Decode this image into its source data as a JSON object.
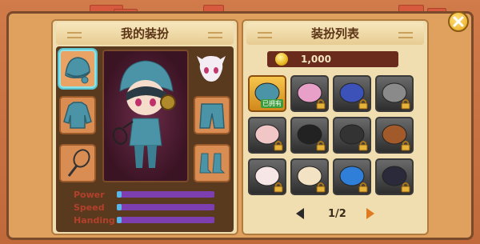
{
  "left_panel": {
    "title": "我的装扮"
  },
  "right_panel": {
    "title": "装扮列表"
  },
  "currency": {
    "amount": "1,000",
    "icon": "coin-icon"
  },
  "stats": [
    {
      "label": "Power",
      "value": 0.05
    },
    {
      "label": "Speed",
      "value": 0.05
    },
    {
      "label": "Handing",
      "value": 0.05
    }
  ],
  "equipped_slots": [
    "hat-slot",
    "top-slot",
    "racket-slot",
    "pants-slot",
    "shoes-slot"
  ],
  "items": [
    {
      "name": "blue-cap-item",
      "owned": true,
      "owned_label": "已拥有"
    },
    {
      "name": "pink-helmet-item",
      "owned": false
    },
    {
      "name": "blue-helmet-item",
      "owned": false
    },
    {
      "name": "cat-hat-item",
      "owned": false
    },
    {
      "name": "piggy-hat-item",
      "owned": false
    },
    {
      "name": "black-helmet-item",
      "owned": false
    },
    {
      "name": "black-cap-item",
      "owned": false
    },
    {
      "name": "bear-hat-item",
      "owned": false
    },
    {
      "name": "bunny-hat-item",
      "owned": false
    },
    {
      "name": "cream-hat-item",
      "owned": false
    },
    {
      "name": "blue-egg-item",
      "owned": false
    },
    {
      "name": "top-hat-item",
      "owned": false
    }
  ],
  "pager": {
    "text": "1/2"
  },
  "colors": {
    "accent_purple": "#7d3fb0",
    "fill_blue": "#58b7e6",
    "stat_red": "#b2402a"
  }
}
